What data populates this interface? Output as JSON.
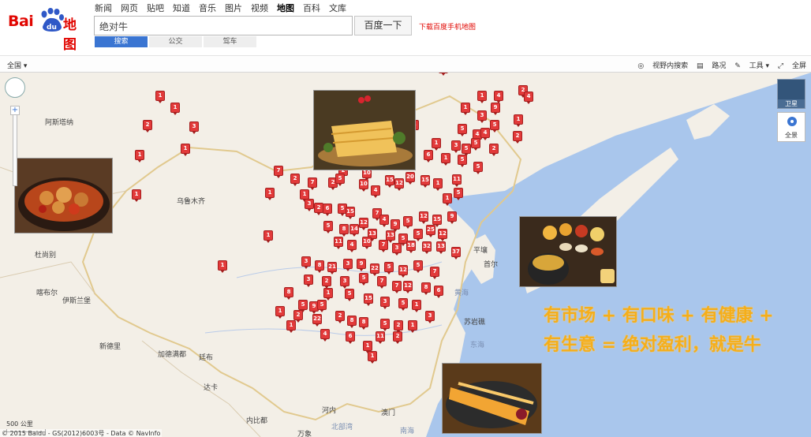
{
  "header": {
    "logo_text": "Bai",
    "logo_paw_text": "du",
    "logo_map": "地图",
    "nav": [
      "新闻",
      "网页",
      "贴吧",
      "知道",
      "音乐",
      "图片",
      "视频",
      "地图",
      "百科",
      "文库"
    ],
    "search_value": "绝对牛",
    "search_button": "百度一下",
    "download_link": "下载百度手机地图",
    "mode_tabs": [
      "搜索",
      "公交",
      "驾车"
    ]
  },
  "toolbar": {
    "scope": "全国",
    "items": [
      "视野内搜索",
      "路况",
      "工具",
      "全屏"
    ]
  },
  "map_controls": {
    "satellite_label": "卫星",
    "pano_label": "全景",
    "scale_label": "500 公里",
    "copyright": "© 2015 Baidu - GS(2012)6003号 - Data © NavInfo"
  },
  "places": [
    {
      "name": "阿斯塔纳"
    },
    {
      "name": "乌鲁木齐"
    },
    {
      "name": "杜尚别"
    },
    {
      "name": "伊斯兰堡"
    },
    {
      "name": "喀布尔"
    },
    {
      "name": "新德里"
    },
    {
      "name": "加德满都"
    },
    {
      "name": "廷布"
    },
    {
      "name": "达卡"
    },
    {
      "name": "内比都"
    },
    {
      "name": "万象"
    },
    {
      "name": "河内"
    },
    {
      "name": "澳门"
    },
    {
      "name": "平壤"
    },
    {
      "name": "首尔"
    },
    {
      "name": "苏岩礁"
    },
    {
      "name": "黄海",
      "sea": true
    },
    {
      "name": "东海",
      "sea": true
    },
    {
      "name": "北部湾",
      "sea": true
    },
    {
      "name": "南海",
      "sea": true
    }
  ],
  "promo": {
    "line1": "有市场 + 有口味 + 有健康 +",
    "line2": "有生意 = 绝对盈利，就是牛"
  },
  "colors": {
    "brand_red": "#e10601",
    "marker_red": "#e23a3a",
    "promo_orange": "#f5ae1a",
    "sea_blue": "#a9c6ec"
  }
}
